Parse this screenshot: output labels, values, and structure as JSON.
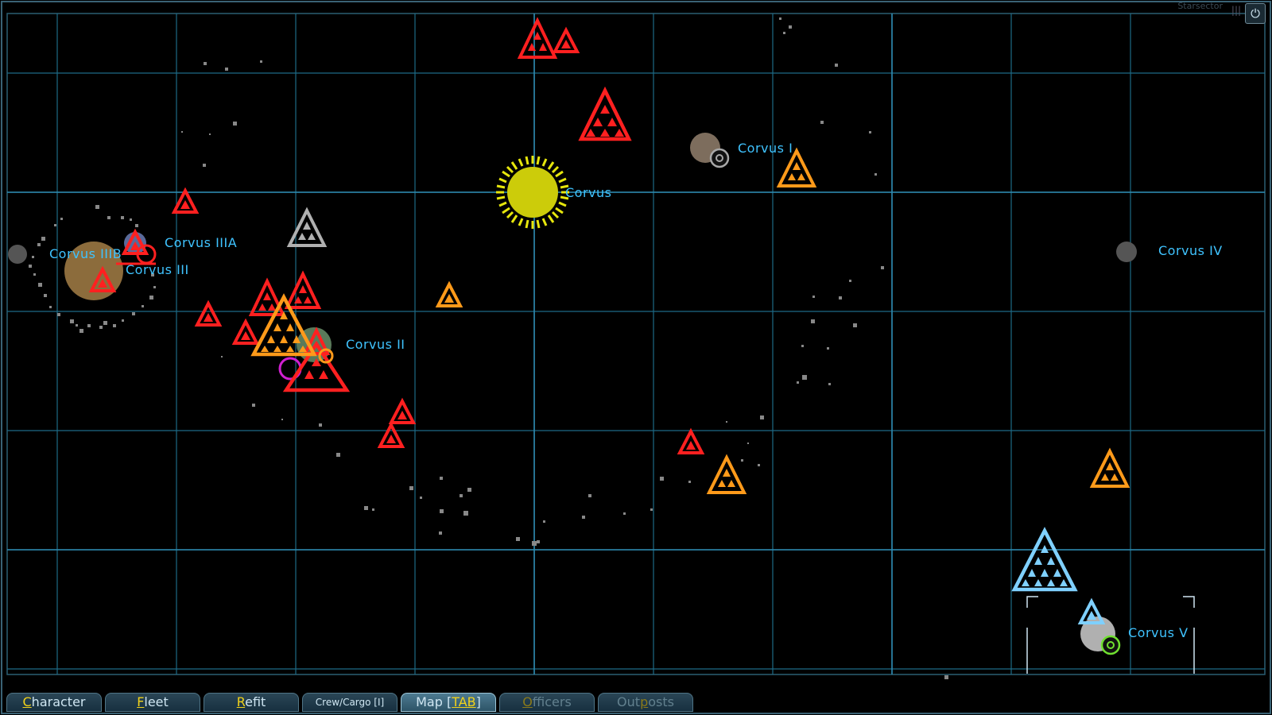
{
  "window": {
    "corner_title": "Starsector",
    "corner_button": "⏻",
    "corner_menu": "|||"
  },
  "system": {
    "star": "Corvus"
  },
  "bodies": {
    "corvus_i": "Corvus I",
    "corvus_ii": "Corvus II",
    "corvus_iii": "Corvus III",
    "corvus_iiia": "Corvus IIIA",
    "corvus_iiib": "Corvus IIIB",
    "corvus_iv": "Corvus IV",
    "corvus_v": "Corvus V"
  },
  "fleet_icons": [
    {
      "name": "fleet-red-icon",
      "color": "#ff2020",
      "size": "large"
    },
    {
      "name": "fleet-red-icon",
      "color": "#ff2020",
      "size": "small"
    },
    {
      "name": "fleet-red-icon",
      "color": "#ff2020",
      "size": "large"
    },
    {
      "name": "fleet-orange-icon",
      "color": "#ff9a1a",
      "size": "medium"
    },
    {
      "name": "fleet-red-icon",
      "color": "#ff2020",
      "size": "small"
    },
    {
      "name": "fleet-gray-icon",
      "color": "#b0b0b0",
      "size": "medium"
    },
    {
      "name": "fleet-orange-icon",
      "color": "#ff9a1a",
      "size": "huge"
    },
    {
      "name": "fleet-orange-icon",
      "color": "#ff9a1a",
      "size": "small"
    },
    {
      "name": "fleet-red-icon",
      "color": "#ff2020",
      "size": "small"
    },
    {
      "name": "fleet-orange-icon",
      "color": "#ff9a1a",
      "size": "medium"
    },
    {
      "name": "fleet-orange-icon",
      "color": "#ff9a1a",
      "size": "medium"
    },
    {
      "name": "fleet-player-icon",
      "color": "#7fd0ff",
      "size": "huge"
    },
    {
      "name": "fleet-cyan-icon",
      "color": "#7fd0ff",
      "size": "small"
    }
  ],
  "tabs": [
    {
      "pre": "",
      "key": "C",
      "post": "haracter",
      "state": "normal",
      "size": "normal"
    },
    {
      "pre": "",
      "key": "F",
      "post": "leet",
      "state": "normal",
      "size": "normal"
    },
    {
      "pre": "",
      "key": "R",
      "post": "efit",
      "state": "normal",
      "size": "normal"
    },
    {
      "pre": "Crew/Cargo [I]",
      "key": "",
      "post": "",
      "state": "normal",
      "size": "small"
    },
    {
      "pre": "Map [",
      "key": "TAB",
      "post": "]",
      "state": "active",
      "size": "normal"
    },
    {
      "pre": "",
      "key": "O",
      "post": "fficers",
      "state": "disabled",
      "size": "normal"
    },
    {
      "pre": "Out",
      "key": "p",
      "post": "osts",
      "state": "disabled",
      "size": "normal"
    }
  ],
  "colors": {
    "grid": "#1d6a86",
    "label": "#3fc3ff",
    "hostile": "#ff2020",
    "neutral": "#ff9a1a",
    "player": "#7fd0ff",
    "star": "#d8d60a"
  }
}
